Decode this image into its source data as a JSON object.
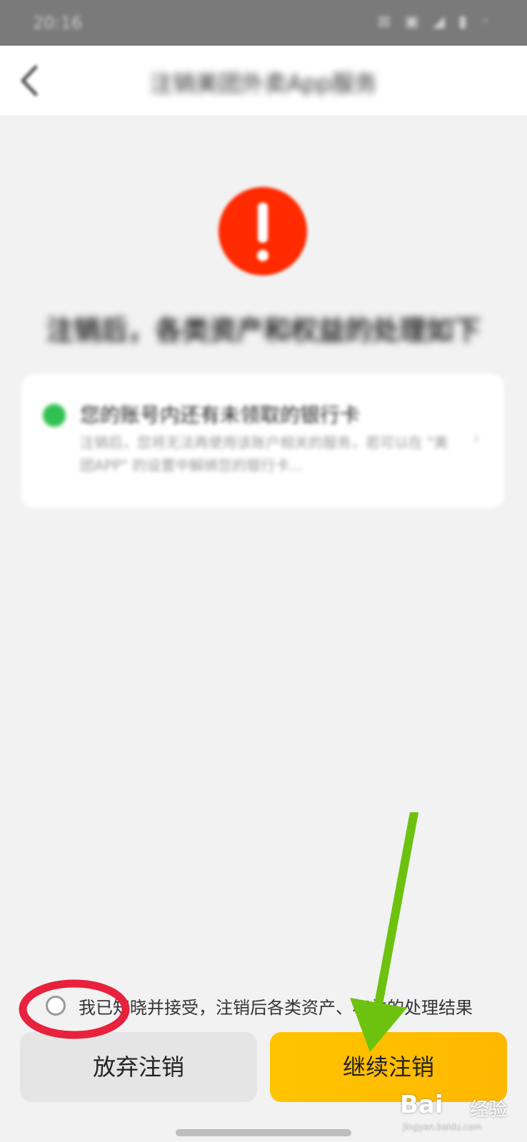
{
  "status_bar": {
    "time": "20:16",
    "icons": "⊠ ▣ ◢ ▮ ◦"
  },
  "header": {
    "title": "注销美团外卖App服务",
    "back_icon": "chevron-left-icon"
  },
  "warning": {
    "icon": "exclamation-icon",
    "color": "#ff2a00"
  },
  "headline": "注销后，各类资产和权益的处理如下",
  "info_card": {
    "title": "您的账号内还有未领取的银行卡",
    "description": "注销后，您将无法再使用该账户相关的服务，若可以在 \"美团APP\" 的设置中解绑您的银行卡...",
    "status_color": "#2fc14f",
    "arrow_icon": "chevron-right-icon"
  },
  "consent": {
    "text": "我已知晓并接受，注销后各类资产、权益的处理结果"
  },
  "buttons": {
    "cancel_label": "放弃注销",
    "continue_label": "继续注销"
  },
  "colors": {
    "accent": "#ffc400",
    "annotation_red": "#e8213c",
    "annotation_green": "#6cc20f"
  },
  "watermark": {
    "logo": "Bai",
    "brand": "经验",
    "url": "jingyan.baidu.com"
  }
}
